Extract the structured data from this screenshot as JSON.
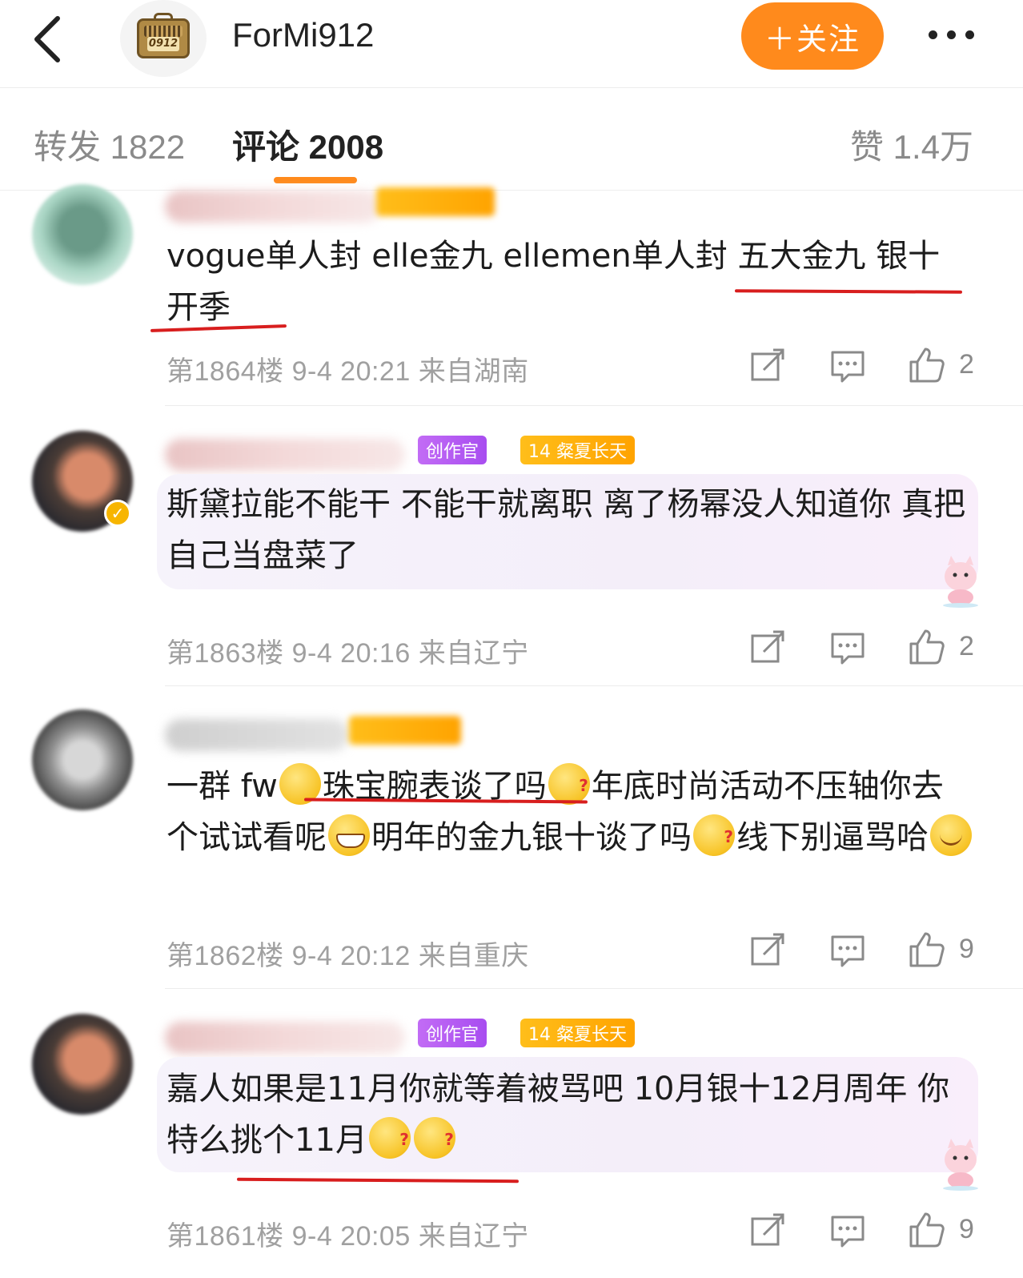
{
  "header": {
    "channel_name": "ForMi912",
    "avatar_plate": "0912",
    "follow_label": "＋关注"
  },
  "tabs": {
    "repost": "转发 1822",
    "comments": "评论 2008",
    "likes": "赞 1.4万"
  },
  "comments": [
    {
      "badges": [],
      "text": "vogue单人封 elle金九 ellemen单人封 五大金九 银十 开季",
      "meta": "第1864楼 9-4 20:21 来自湖南",
      "likes": "2"
    },
    {
      "badges": [
        "创作官",
        "14 粲夏长天"
      ],
      "text": "斯黛拉能不能干 不能干就离职 离了杨幂没人知道你 真把自己当盘菜了",
      "meta": "第1863楼 9-4 20:16 来自辽宁",
      "likes": "2"
    },
    {
      "badges": [],
      "text_parts": [
        "一群 fw",
        "珠宝腕表谈了吗",
        "年底时尚活动不压轴你去个试试看呢",
        "明年的金九银十谈了吗",
        "线下别逼骂哈"
      ],
      "meta": "第1862楼 9-4 20:12 来自重庆",
      "likes": "9"
    },
    {
      "badges": [
        "创作官",
        "14 粲夏长天"
      ],
      "text_parts": [
        "嘉人如果是11月你就等着被骂吧 10月银十12月周年 你特么挑个11月"
      ],
      "meta": "第1861楼 9-4 20:05 来自辽宁",
      "likes": "9"
    }
  ]
}
